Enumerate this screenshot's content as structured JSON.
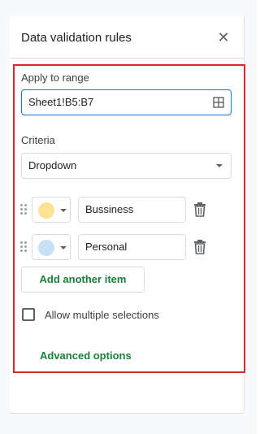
{
  "panel": {
    "title": "Data validation rules",
    "close_icon": "close-icon"
  },
  "range": {
    "label": "Apply to range",
    "value": "Sheet1!B5:B7",
    "icon": "select-range-grid-icon"
  },
  "criteria": {
    "label": "Criteria",
    "selected": "Dropdown"
  },
  "items": [
    {
      "value": "Bussiness",
      "color": "#fde293"
    },
    {
      "value": "Personal",
      "color": "#c6e1f5"
    }
  ],
  "add_item_label": "Add another item",
  "multiple_selections": {
    "label": "Allow multiple selections",
    "checked": false
  },
  "advanced_options_label": "Advanced options",
  "colors": {
    "accent_blue": "#1a73e8",
    "link_green": "#188038",
    "highlight_red": "#e0242b"
  }
}
